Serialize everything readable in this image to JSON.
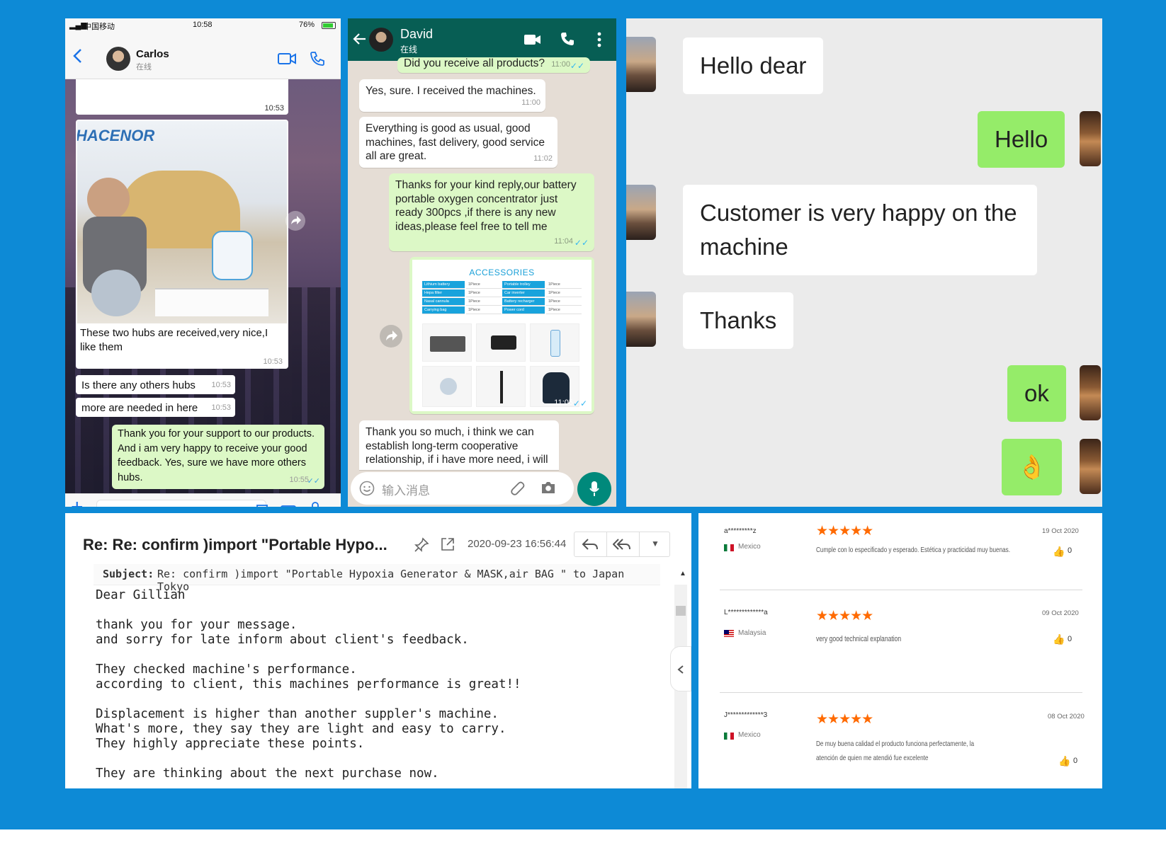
{
  "wechat": {
    "status_carrier": "中国移动",
    "status_time": "10:58",
    "status_battery": "76%",
    "contact_name": "Carlos",
    "contact_status": "在线",
    "brand_logo": "HACENOR",
    "top_time": "10:53",
    "messages": [
      {
        "text": "These two hubs are received,very nice,I like them",
        "time": "10:53"
      },
      {
        "text": "Is there any others hubs",
        "time": "10:53"
      },
      {
        "text": "more are needed in here",
        "time": "10:53"
      },
      {
        "text": "Thank you for your support to our products. And i am very happy to receive your good feedback. Yes, sure we have more others hubs.",
        "time": "10:55"
      }
    ]
  },
  "whatsapp": {
    "contact_name": "David",
    "contact_status": "在线",
    "first_msg": "Did you receive all products?",
    "first_time": "11:00",
    "messages": [
      {
        "text": "Yes, sure. I received the machines.",
        "time": "11:00"
      },
      {
        "text": "Everything is good as usual, good machines, fast delivery, good service all are great.",
        "time": "11:02"
      },
      {
        "text": "Thanks for your kind reply,our battery portable oxygen concentrator just ready 300pcs ,if there is any new ideas,please feel free to tell me",
        "time": "11:04"
      },
      {
        "text": "Thank you so much, i think we can establish long-term cooperative relationship, if i have more need, i will",
        "time": ""
      }
    ],
    "image_title": "ACCESSORIES",
    "image_time": "11:05",
    "accessory_rows": [
      [
        "Lithium battery",
        "1Piece",
        "Portable trolley",
        "1Piece"
      ],
      [
        "Hepa filter",
        "1Piece",
        "Car inverter",
        "1Piece"
      ],
      [
        "Nasal cannula",
        "1Piece",
        "Battery recharger",
        "1Piece"
      ],
      [
        "Carrying bag",
        "1Piece",
        "Power cord",
        "1Piece"
      ]
    ],
    "input_placeholder": "输入消息"
  },
  "chat": {
    "messages": [
      {
        "side": "left",
        "text": "Hello dear"
      },
      {
        "side": "right",
        "text": "Hello"
      },
      {
        "side": "left",
        "text": "Customer is very happy on the machine"
      },
      {
        "side": "left",
        "text": "Thanks"
      },
      {
        "side": "right",
        "text": "ok"
      },
      {
        "side": "right",
        "text": "👌"
      }
    ]
  },
  "email": {
    "subject_title": "Re: Re: confirm )import \"Portable Hypo...",
    "date": "2020-09-23 16:56:44",
    "subject_label": "Subject:",
    "subject_full": "Re: confirm )import \"Portable Hypoxia Generator & MASK,air BAG \" to Japan Tokyo",
    "body_lines": [
      "Dear Gillian",
      "",
      "thank you for your message.",
      "and sorry for late inform about client's feedback.",
      "",
      "They checked machine's performance.",
      "according to client, this machines performance is great!!",
      "",
      "Displacement is higher than another suppler's machine.",
      "What's more, they say they are light and easy to carry.",
      "They highly appreciate these points.",
      "",
      "They are thinking about the next purchase now."
    ]
  },
  "reviews": [
    {
      "user": "a*********z",
      "country": "Mexico",
      "stars": "★★★★★",
      "date": "19 Oct 2020",
      "text": "Cumple con lo especificado y esperado. Estética y practicidad muy buenas.",
      "likes": "0"
    },
    {
      "user": "L*************a",
      "country": "Malaysia",
      "stars": "★★★★★",
      "date": "09 Oct 2020",
      "text": "very good technical explanation",
      "likes": "0"
    },
    {
      "user": "J*************3",
      "country": "Mexico",
      "stars": "★★★★★",
      "date": "08 Oct 2020",
      "text": "De muy buena calidad el producto funciona perfectamente, la atención de quien me atendió fue excelente",
      "likes": "0"
    }
  ]
}
